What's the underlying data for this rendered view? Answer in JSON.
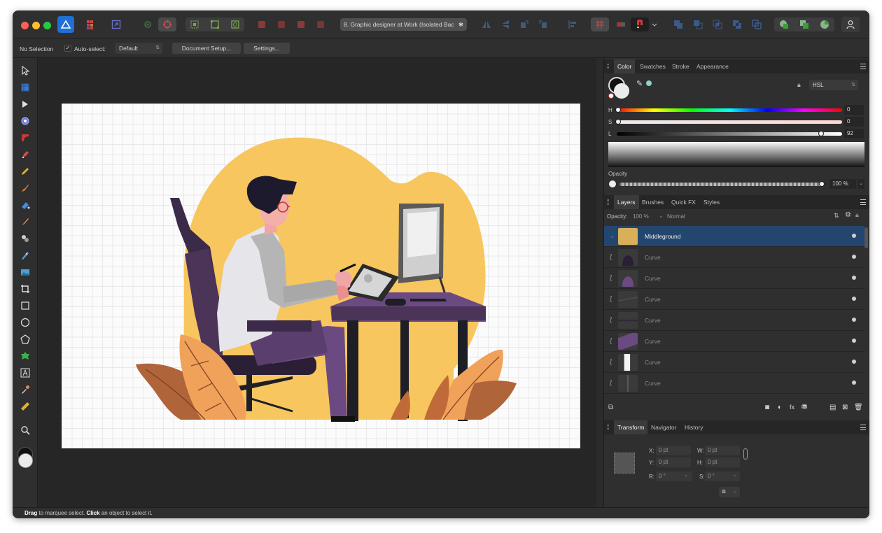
{
  "document": {
    "tab_title": "8. Graphic designer at Work (Isolated Bac",
    "tab_close": "✱"
  },
  "context_bar": {
    "selection_status": "No Selection",
    "auto_select_label": "Auto-select:",
    "auto_select_checked": true,
    "auto_select_value": "Default",
    "document_setup_button": "Document Setup...",
    "settings_button": "Settings..."
  },
  "color_panel": {
    "tabs": [
      "Color",
      "Swatches",
      "Stroke",
      "Appearance"
    ],
    "active_tab": "Color",
    "mode_value": "HSL",
    "sliders": [
      {
        "label": "H",
        "value": "0"
      },
      {
        "label": "S",
        "value": "0"
      },
      {
        "label": "L",
        "value": "92"
      }
    ],
    "opacity_label": "Opacity",
    "opacity_value": "100 %"
  },
  "layers_panel": {
    "tabs": [
      "Layers",
      "Brushes",
      "Quick FX",
      "Styles"
    ],
    "active_tab": "Layers",
    "opacity_label": "Opacity:",
    "opacity_value": "100 %",
    "blend_mode": "Normal",
    "layers": [
      {
        "name": "Middleground",
        "selected": true
      },
      {
        "name": "Curve",
        "selected": false
      },
      {
        "name": "Curve",
        "selected": false
      },
      {
        "name": "Curve",
        "selected": false
      },
      {
        "name": "Curve",
        "selected": false
      },
      {
        "name": "Curve",
        "selected": false
      },
      {
        "name": "Curve",
        "selected": false
      },
      {
        "name": "Curve",
        "selected": false
      }
    ]
  },
  "transform_panel": {
    "tabs": [
      "Transform",
      "Navigator",
      "History"
    ],
    "active_tab": "Transform",
    "x_label": "X:",
    "x_value": "0 pt",
    "y_label": "Y:",
    "y_value": "0 pt",
    "w_label": "W:",
    "w_value": "0 pt",
    "h_label": "H:",
    "h_value": "0 pt",
    "r_label": "R:",
    "r_value": "0 °",
    "s_label": "S:",
    "s_value": "0 °"
  },
  "status_bar": {
    "drag_word": "Drag",
    "drag_text": " to marquee select. ",
    "click_word": "Click",
    "click_text": " an object to select it."
  },
  "colors": {
    "accent_blue": "#3d8be0",
    "purple": "#5b3e6e",
    "yellow_blob": "#f7c65e",
    "leaf_orange": "#f0a25a"
  }
}
